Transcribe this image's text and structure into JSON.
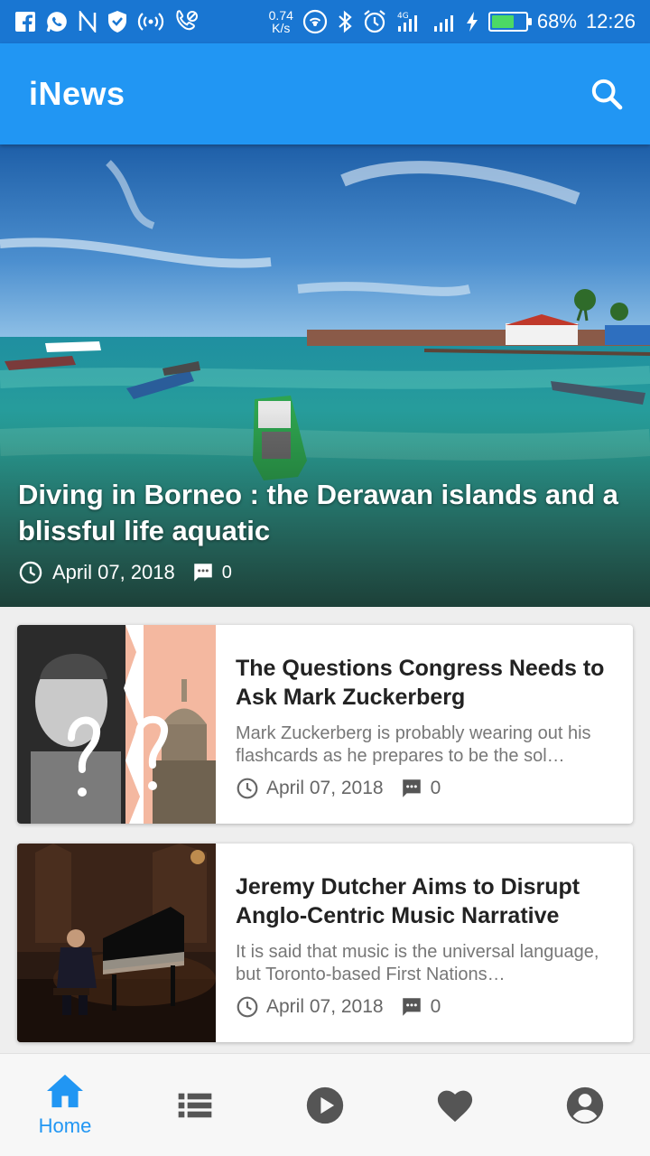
{
  "status_bar": {
    "net_speed_value": "0.74",
    "net_speed_unit": "K/s",
    "network_label": "4G",
    "battery_percent": "68%",
    "battery_level": 0.68,
    "time": "12:26",
    "left_icons": [
      "facebook-icon",
      "whatsapp-icon",
      "n-icon",
      "vpn-shield-icon",
      "hotspot-icon",
      "call-forward-icon"
    ],
    "right_icons": [
      "wifi-icon",
      "bluetooth-icon",
      "alarm-icon",
      "signal-icon",
      "signal-icon",
      "charging-icon"
    ]
  },
  "app_bar": {
    "title": "iNews",
    "search_icon": "search-icon"
  },
  "hero": {
    "title": "Diving in Borneo : the Derawan islands and a blissful life aquatic",
    "date": "April 07, 2018",
    "comments": "0"
  },
  "articles": [
    {
      "title": "The Questions Congress Needs to Ask Mark Zuckerberg",
      "description": "Mark Zuckerberg is probably wearing out his flashcards as he prepares to be the sol…",
      "date": "April 07, 2018",
      "comments": "0"
    },
    {
      "title": "Jeremy Dutcher Aims to Disrupt Anglo-Centric Music Narrative",
      "description": "It is said that music is the universal language, but Toronto-based First Nations…",
      "date": "April 07, 2018",
      "comments": "0"
    }
  ],
  "bottom_nav": {
    "items": [
      {
        "icon": "home-icon",
        "label": "Home",
        "active": true
      },
      {
        "icon": "list-icon",
        "label": "",
        "active": false
      },
      {
        "icon": "play-icon",
        "label": "",
        "active": false
      },
      {
        "icon": "heart-icon",
        "label": "",
        "active": false
      },
      {
        "icon": "account-icon",
        "label": "",
        "active": false
      }
    ]
  },
  "colors": {
    "status_bar": "#1976D2",
    "app_bar": "#2196F3",
    "accent": "#2196F3",
    "inactive_icon": "#555555"
  }
}
